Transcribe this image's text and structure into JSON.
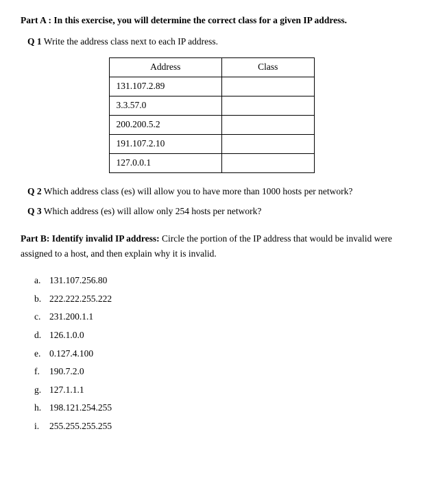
{
  "partA": {
    "header": "Part A :",
    "headerText": " In this exercise, you will determine the correct class for a given IP address.",
    "q1": {
      "label": "Q 1",
      "text": " Write the address class next to each IP address."
    },
    "table": {
      "col1": "Address",
      "col2": "Class",
      "rows": [
        {
          "address": "131.107.2.89",
          "class": ""
        },
        {
          "address": "3.3.57.0",
          "class": ""
        },
        {
          "address": "200.200.5.2",
          "class": ""
        },
        {
          "address": "191.107.2.10",
          "class": ""
        },
        {
          "address": "127.0.0.1",
          "class": ""
        }
      ]
    },
    "q2": {
      "label": "Q 2",
      "text": " Which address class (es) will allow you to have more than 1000 hosts per network?"
    },
    "q3": {
      "label": "Q 3",
      "text": " Which address (es) will allow only 254 hosts per network?"
    }
  },
  "partB": {
    "header": "Part B: Identify invalid IP address:",
    "headerText": " Circle the portion of the IP address that would be invalid were assigned to a host, and then explain why it is invalid.",
    "items": [
      {
        "label": "a.",
        "value": "131.107.256.80"
      },
      {
        "label": "b.",
        "value": "222.222.255.222"
      },
      {
        "label": "c.",
        "value": "231.200.1.1"
      },
      {
        "label": "d.",
        "value": "126.1.0.0"
      },
      {
        "label": "e.",
        "value": "0.127.4.100"
      },
      {
        "label": "f.",
        "value": "190.7.2.0"
      },
      {
        "label": "g.",
        "value": "127.1.1.1"
      },
      {
        "label": "h.",
        "value": "198.121.254.255"
      },
      {
        "label": "i.",
        "value": "255.255.255.255"
      }
    ]
  }
}
